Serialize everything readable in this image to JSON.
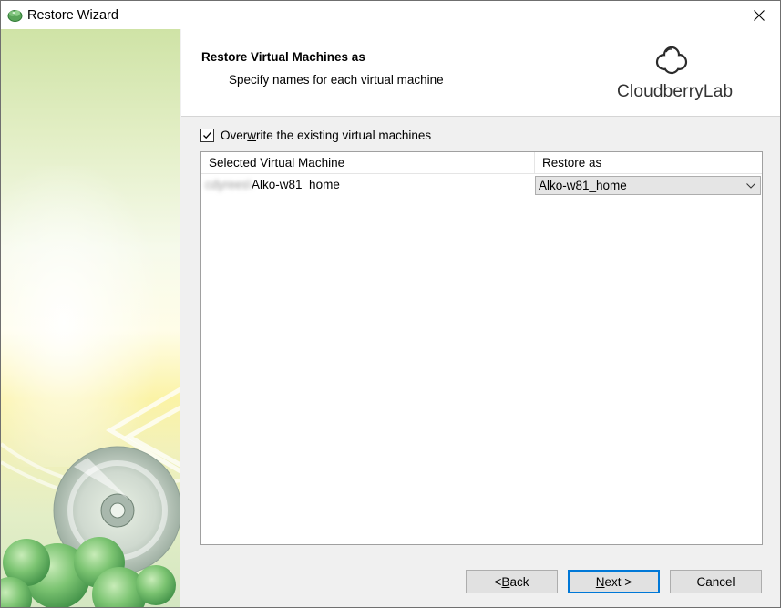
{
  "window": {
    "title": "Restore Wizard"
  },
  "header": {
    "title": "Restore Virtual Machines as",
    "subtitle": "Specify names for each virtual machine",
    "logo_text": "CloudberryLab"
  },
  "options": {
    "overwrite_label_pre": "Over",
    "overwrite_label_accel": "w",
    "overwrite_label_post": "rite the existing virtual machines",
    "overwrite_checked": true
  },
  "grid": {
    "columns": [
      "Selected Virtual Machine",
      "Restore as"
    ],
    "rows": [
      {
        "vm_prefix": "cdyrees\\",
        "vm_name": "Alko-w81_home",
        "restore_as": "Alko-w81_home"
      }
    ]
  },
  "buttons": {
    "back_pre": "< ",
    "back_accel": "B",
    "back_post": "ack",
    "next_accel": "N",
    "next_post": "ext >",
    "cancel": "Cancel"
  },
  "colors": {
    "default_button_border": "#0078d7",
    "button_face": "#e1e1e1",
    "dialog_background": "#f0f0f0"
  }
}
